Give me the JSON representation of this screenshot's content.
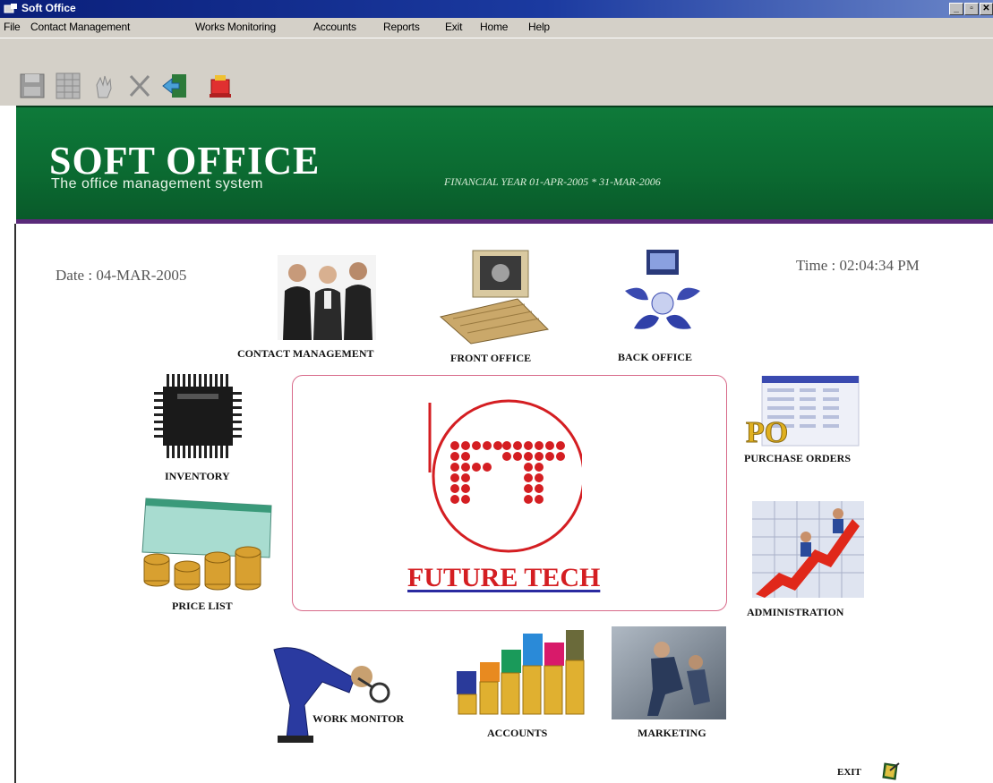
{
  "window": {
    "title": "Soft Office",
    "controls": [
      "minimize",
      "restore",
      "close"
    ]
  },
  "menu": {
    "items": [
      "File",
      "Contact Management",
      "Works Monitoring",
      "Accounts",
      "Reports",
      "Exit",
      "Home",
      "Help"
    ]
  },
  "toolbar": {
    "buttons": [
      "save-icon",
      "grid-icon",
      "hand-icon",
      "cross-icon",
      "exit-door-icon",
      "alarm-icon"
    ]
  },
  "banner": {
    "title": "SOFT OFFICE",
    "subtitle": "The office management system",
    "financial_year": "FINANCIAL YEAR 01-APR-2005 * 31-MAR-2006"
  },
  "status": {
    "date": "Date : 04-MAR-2005",
    "time": "Time : 02:04:34 PM"
  },
  "modules": {
    "contact_management": "CONTACT MANAGEMENT",
    "front_office": "FRONT OFFICE",
    "back_office": "BACK OFFICE",
    "inventory": "INVENTORY",
    "purchase_orders": "PURCHASE ORDERS",
    "price_list": "PRICE LIST",
    "administration": "ADMINISTRATION",
    "work_monitor": "WORK MONITOR",
    "accounts": "ACCOUNTS",
    "marketing": "MARKETING",
    "exit": "EXIT"
  },
  "logo": {
    "text": "FUTURE TECH",
    "mark": "FT",
    "po_badge": "PO"
  },
  "colors": {
    "banner_green": "#0b6a31",
    "logo_red": "#d41e22",
    "title_bar": "#0a1f7a"
  }
}
